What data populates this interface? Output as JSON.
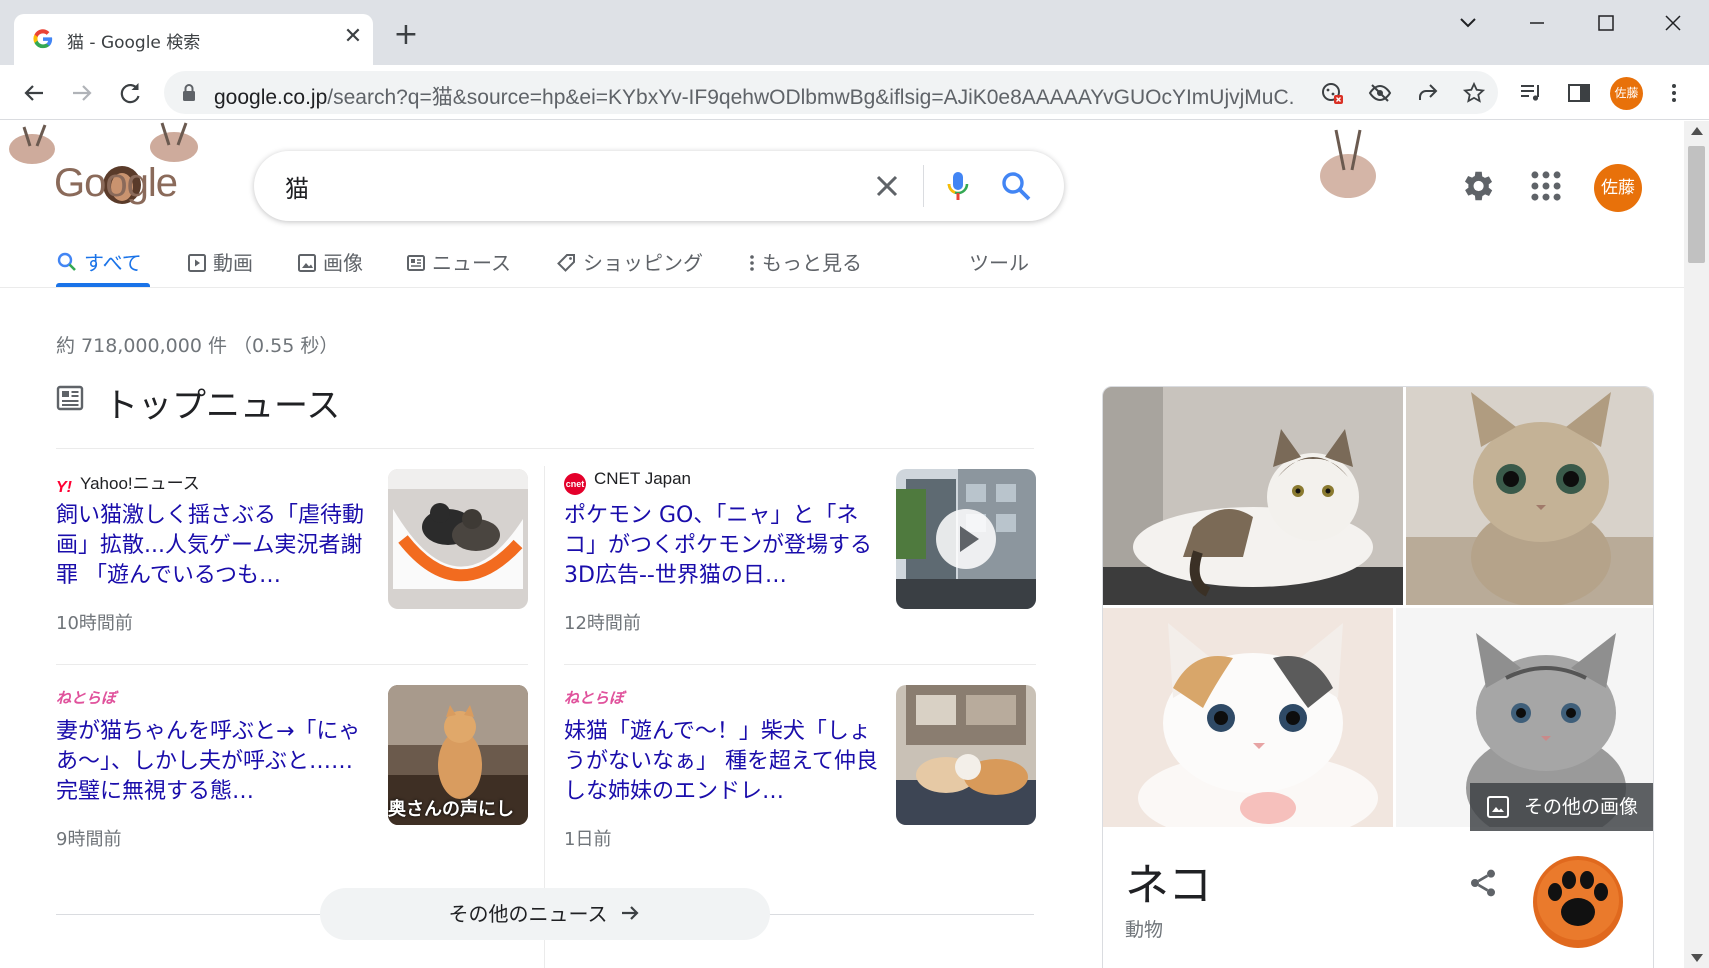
{
  "browser": {
    "tab_title": "猫 - Google 検索",
    "tab_close": "✕",
    "new_tab": "+",
    "url_host": "google.co.jp",
    "url_path": "/search?q=猫&source=hp&ei=KYbxYv-IF9qehwODlbmwBg&iflsig=AJiK0e8AAAAAYvGUOcYImUjvjMuC...",
    "profile_initials": "佐藤"
  },
  "google": {
    "doodle_text": "Google",
    "query": "猫",
    "user_initials": "佐藤"
  },
  "tabs": [
    {
      "label": "すべて"
    },
    {
      "label": "動画"
    },
    {
      "label": "画像"
    },
    {
      "label": "ニュース"
    },
    {
      "label": "ショッピング"
    },
    {
      "label": "もっと見る"
    },
    {
      "label": "ツール"
    }
  ],
  "result_stats": "約 718,000,000 件 （0.55 秒）",
  "top_news": {
    "heading": "トップニュース",
    "more_label": "その他のニュース",
    "cards": [
      {
        "source": "Yahoo!ニュース",
        "headline": "飼い猫激しく揺さぶる「虐待動画」拡散...人気ゲーム実況者謝罪 「遊んでいるつも…",
        "time": "10時間前",
        "logo_text": "Y!"
      },
      {
        "source": "CNET Japan",
        "headline": "ポケモン GO、「ニャ」と「ネコ」がつくポケモンが登場する3D広告--世界猫の日…",
        "time": "12時間前",
        "logo_text": "cnet"
      },
      {
        "source": "ねとらぼ",
        "headline": "妻が猫ちゃんを呼ぶと→「にゃあ～」、しかし夫が呼ぶと…… 完璧に無視する態…",
        "time": "9時間前",
        "logo_text": "ねとらぼ",
        "thumb_caption": "奥さんの声にし"
      },
      {
        "source": "ねとらぼ",
        "headline": "妹猫「遊んで～！」柴犬「しょうがないなぁ」 種を超えて仲良しな姉妹のエンドレ…",
        "time": "1日前",
        "logo_text": "ねとらぼ"
      }
    ]
  },
  "knowledge_panel": {
    "title": "ネコ",
    "subtitle": "動物",
    "more_images": "その他の画像"
  },
  "colors": {
    "link": "#1a0dab",
    "accent": "#1a73e8",
    "avatar": "#e8710a"
  }
}
